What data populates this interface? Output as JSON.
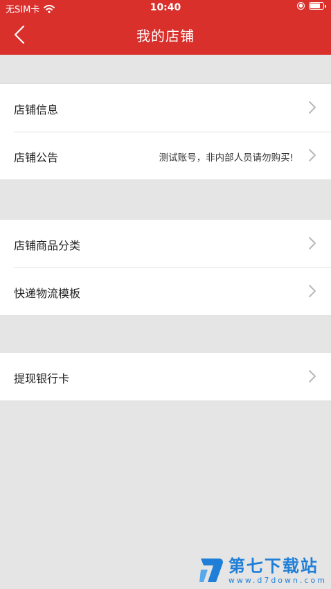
{
  "status_bar": {
    "carrier": "无SIM卡",
    "time": "10:40",
    "battery_level": 0.8,
    "icons": [
      "wifi-icon",
      "orientation-lock-icon",
      "battery-icon"
    ]
  },
  "navbar": {
    "title": "我的店铺",
    "back_icon": "chevron-left-icon"
  },
  "groups": [
    {
      "items": [
        {
          "label": "店铺信息",
          "value": ""
        },
        {
          "label": "店铺公告",
          "value": "测试账号，非内部人员请勿购买!"
        }
      ]
    },
    {
      "items": [
        {
          "label": "店铺商品分类",
          "value": ""
        },
        {
          "label": "快递物流模板",
          "value": ""
        }
      ]
    },
    {
      "items": [
        {
          "label": "提现银行卡",
          "value": ""
        }
      ]
    }
  ],
  "watermark": {
    "title": "第七下载站",
    "url": "www.d7down.com"
  },
  "colors": {
    "header": "#d9302c",
    "background": "#e5e5e5",
    "chevron": "#b8b8b8",
    "watermark": "#1f7fd8"
  }
}
